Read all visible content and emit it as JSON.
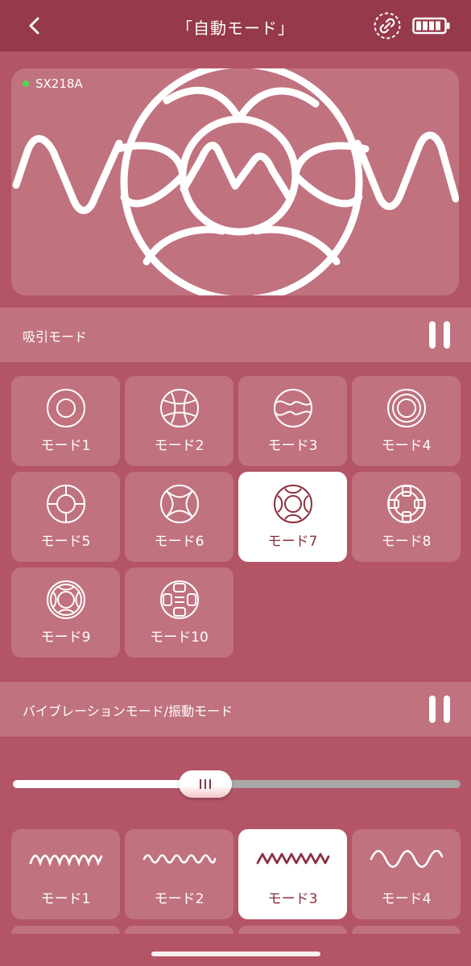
{
  "header": {
    "title": "「自動モード」",
    "back_icon": "chevron-left-icon",
    "link_icon": "link-dashed-circle-icon",
    "battery_icon": "battery-icon"
  },
  "device": {
    "name": "SX218A",
    "connected": true,
    "status_color": "#4cd84c"
  },
  "suction": {
    "label": "吸引モード",
    "selected": 7,
    "modes": [
      {
        "label": "モード1",
        "icon": "concentric-circle-icon"
      },
      {
        "label": "モード2",
        "icon": "ball-icon"
      },
      {
        "label": "モード3",
        "icon": "wave-circle-icon"
      },
      {
        "label": "モード4",
        "icon": "triple-ring-icon"
      },
      {
        "label": "モード5",
        "icon": "lifebuoy-icon"
      },
      {
        "label": "モード6",
        "icon": "x-petal-circle-icon"
      },
      {
        "label": "モード7",
        "icon": "lifebuoy-ring-icon"
      },
      {
        "label": "モード8",
        "icon": "cross-ring-icon"
      },
      {
        "label": "モード9",
        "icon": "double-lifebuoy-icon"
      },
      {
        "label": "モード10",
        "icon": "grid-circle-icon"
      }
    ]
  },
  "vibration": {
    "label": "バイブレーションモード/振動モード",
    "intensity_fraction": 0.43,
    "selected": 3,
    "modes": [
      {
        "label": "モード1",
        "icon": "zigzag-wave-icon"
      },
      {
        "label": "モード2",
        "icon": "small-wave-icon"
      },
      {
        "label": "モード3",
        "icon": "sharp-zigzag-icon"
      },
      {
        "label": "モード4",
        "icon": "sine-wave-icon"
      }
    ]
  },
  "colors": {
    "background": "#b35566",
    "navbar": "#96394a",
    "card": "#c0727f",
    "active_text": "#8b2e3f"
  }
}
